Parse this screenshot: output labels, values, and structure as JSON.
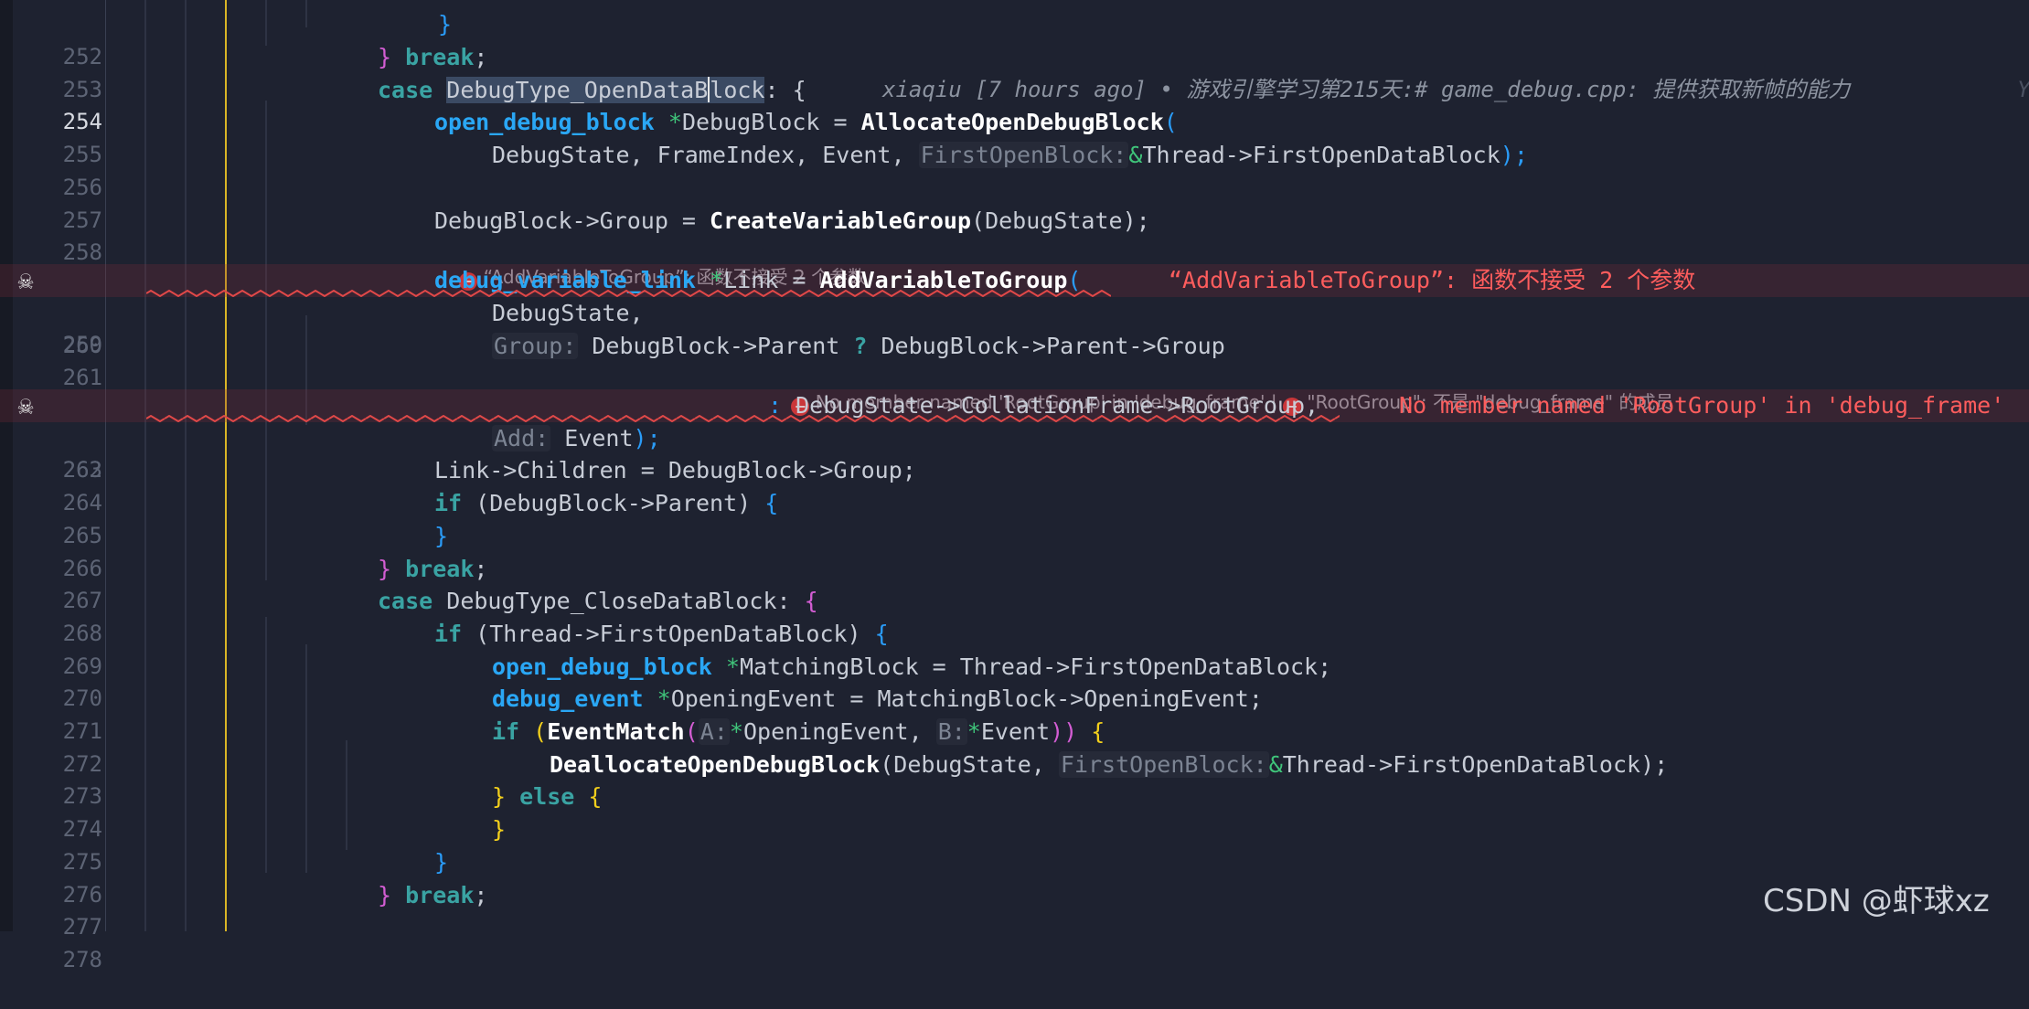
{
  "editor": {
    "lines": [
      {
        "num": "252",
        "parts": []
      },
      {
        "num": "253",
        "parts": []
      },
      {
        "num": "254",
        "parts": []
      }
    ],
    "blame": "xiaqiu [7 hours ago] • 游戏引擎学习第215天:# game_debug.cpp: 提供获取新帧的能力",
    "blame_tail": "Y",
    "codelens_259": "“AddVariableToGroup”: 函数不接受 2 个参数",
    "inline_err_259": "“AddVariableToGroup”: 函数不接受 2 个参数",
    "codelens_262_a": "No member named 'RootGroup' in 'debug_frame'",
    "codelens_262_sep": " | ",
    "codelens_262_b": "\"RootGroup\": 不是 \"debug_frame\" 的成员",
    "inline_err_262": "No member named 'RootGroup' in 'debug_frame'",
    "line_numbers": [
      "252",
      "253",
      "254",
      "255",
      "256",
      "257",
      "258",
      "259",
      "260",
      "261",
      "262",
      "263",
      "264",
      "265",
      "266",
      "267",
      "268",
      "269",
      "270",
      "271",
      "272",
      "273",
      "274",
      "275",
      "276",
      "277",
      "278"
    ]
  },
  "code": {
    "l252": "}",
    "l253_brace": "}",
    "l253_kw": "break",
    "l253_semi": ";",
    "l254_case": "case",
    "l254_id_a": "DebugType_OpenDataB",
    "l254_id_b": "lock",
    "l254_rest": ": {",
    "l255_type": "open_debug_block",
    "l255_ptr": "*",
    "l255_var": "DebugBlock = ",
    "l255_fn": "AllocateOpenDebugBlock",
    "l255_paren": "(",
    "l256_a": "DebugState, FrameIndex, Event, ",
    "l256_hint": "FirstOpenBlock:",
    "l256_amp": "&",
    "l256_b": "Thread->FirstOpenDataBlock",
    "l256_end": ");",
    "l258_a": "DebugBlock->Group = ",
    "l258_fn": "CreateVariableGroup",
    "l258_b": "(DebugState);",
    "l259_type": "debug_variable_link",
    "l259_ptr": "*",
    "l259_var": "Link = ",
    "l259_fn": "AddVariableToGroup",
    "l259_paren": "(",
    "l260": "DebugState,",
    "l261_hint": "Group:",
    "l261_a": "DebugBlock->Parent ",
    "l261_q": "?",
    "l261_b": " DebugBlock->Parent->Group",
    "l262_colon": ":",
    "l262_a": " DebugState->CollationFrame->RootGroup,",
    "l263_hint": "Add:",
    "l263_a": " Event",
    "l263_end": ");",
    "l264": "Link->Children = DebugBlock->Group;",
    "l265_if": "if",
    "l265_a": " (DebugBlock->Parent) ",
    "l265_brace": "{",
    "l266": "}",
    "l267_brace": "}",
    "l267_kw": "break",
    "l267_semi": ";",
    "l268_case": "case",
    "l268_a": " DebugType_CloseDataBlock: ",
    "l268_brace": "{",
    "l269_if": "if",
    "l269_a": " (Thread->FirstOpenDataBlock) ",
    "l269_brace": "{",
    "l270_type": "open_debug_block",
    "l270_ptr": "*",
    "l270_a": "MatchingBlock = Thread->FirstOpenDataBlock;",
    "l271_type": "debug_event",
    "l271_ptr": "*",
    "l271_a": "OpeningEvent = MatchingBlock->OpeningEvent;",
    "l272_if": "if",
    "l272_p1": " (",
    "l272_fn": "EventMatch",
    "l272_p2": "(",
    "l272_hint_a": "A:",
    "l272_ptr_a": "*",
    "l272_a": "OpeningEvent, ",
    "l272_hint_b": "B:",
    "l272_ptr_b": "*",
    "l272_b": "Event",
    "l272_p3": "))",
    "l272_brace": " {",
    "l273_fn": "DeallocateOpenDebugBlock",
    "l273_a": "(DebugState, ",
    "l273_hint": "FirstOpenBlock:",
    "l273_amp": "&",
    "l273_b": "Thread->FirstOpenDataBlock",
    "l273_end": ");",
    "l274_brace": "}",
    "l274_else": " else ",
    "l274_brace2": "{",
    "l275": "}",
    "l276": "}",
    "l277_brace": "}",
    "l277_kw": "break",
    "l277_semi": ";"
  },
  "icons": {
    "error_marker": "skull-icon",
    "lens_error": "error-circle-icon"
  },
  "watermark": "CSDN @虾球xz",
  "colors": {
    "background": "#1e2230",
    "error_line": "#822d37",
    "keyword": "#3ea7ff",
    "error_text": "#ff5d5d"
  }
}
